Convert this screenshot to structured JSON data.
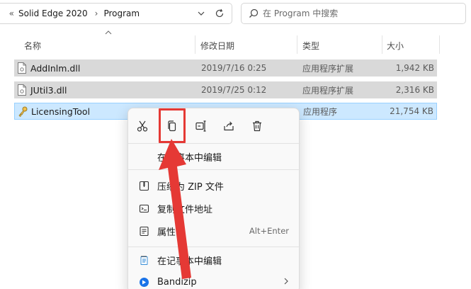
{
  "address": {
    "more": "«",
    "crumbs": [
      "Solid Edge 2020",
      "Program"
    ],
    "separator": "›"
  },
  "search": {
    "placeholder": "在 Program 中搜索"
  },
  "columns": {
    "name": "名称",
    "date": "修改日期",
    "type": "类型",
    "size": "大小"
  },
  "files": [
    {
      "name": "AddInlm.dll",
      "date": "2019/7/16 0:25",
      "type": "应用程序扩展",
      "size": "1,942 KB"
    },
    {
      "name": "JUtil3.dll",
      "date": "2019/7/25 0:12",
      "type": "应用程序扩展",
      "size": "2,316 KB"
    },
    {
      "name": "LicensingTool",
      "date": "",
      "type": "应用程序",
      "size": "21,754 KB"
    }
  ],
  "menu": {
    "quick_actions": [
      "cut-icon",
      "copy-icon",
      "rename-icon",
      "share-icon",
      "delete-icon"
    ],
    "items": [
      {
        "label": "在记事本中编辑",
        "icon": ""
      },
      {
        "label": "压缩为 ZIP 文件",
        "icon": "zip-icon"
      },
      {
        "label": "复制文件地址",
        "icon": "copy-path-icon"
      },
      {
        "label": "属性",
        "icon": "properties-icon",
        "shortcut": "Alt+Enter"
      },
      {
        "label": "在记事本中编辑",
        "icon": "notepad-icon"
      },
      {
        "label": "Bandizip",
        "icon": "bandizip-icon",
        "submenu": true
      }
    ]
  },
  "colors": {
    "selection": "#cce8ff",
    "highlight": "#e53935",
    "bandizip": "#1a73e8"
  }
}
